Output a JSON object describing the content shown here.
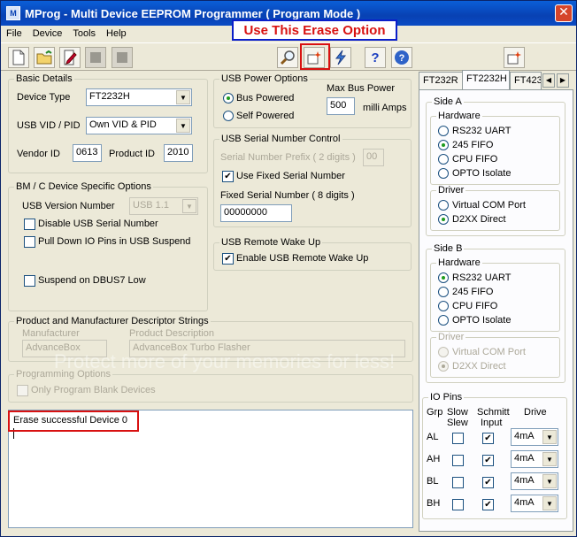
{
  "window": {
    "title": "MProg - Multi Device EEPROM Programmer ( Program Mode )",
    "close": "✕"
  },
  "menu": [
    "File",
    "Device",
    "Tools",
    "Help"
  ],
  "callout": "Use This Erase Option",
  "basic": {
    "legend": "Basic Details",
    "device_type_label": "Device Type",
    "device_type": "FT2232H",
    "vidpid_label": "USB VID / PID",
    "vidpid": "Own VID & PID",
    "vendor_label": "Vendor ID",
    "vendor": "0613",
    "product_label": "Product ID",
    "product": "2010"
  },
  "power": {
    "legend": "USB Power Options",
    "bus": "Bus Powered",
    "self": "Self Powered",
    "max_label": "Max Bus Power",
    "max": "500",
    "unit": "milli Amps"
  },
  "serial": {
    "legend": "USB Serial Number Control",
    "prefix_label": "Serial Number Prefix ( 2 digits )",
    "prefix": "00",
    "fixed_chk": "Use Fixed Serial Number",
    "fixed_label": "Fixed Serial Number ( 8 digits )",
    "fixed": "00000000"
  },
  "bmc": {
    "legend": "BM / C Device Specific Options",
    "usbver_label": "USB Version Number",
    "usbver": "USB 1.1",
    "disable_serial": "Disable USB Serial Number",
    "pulldown": "Pull Down IO Pins in USB Suspend",
    "suspend": "Suspend on DBUS7 Low"
  },
  "wake": {
    "legend": "USB Remote Wake Up",
    "enable": "Enable USB Remote Wake Up"
  },
  "desc": {
    "legend": "Product and Manufacturer Descriptor Strings",
    "manu_label": "Manufacturer",
    "manu": "AdvanceBox",
    "prod_label": "Product Description",
    "prod": "AdvanceBox Turbo Flasher"
  },
  "prog": {
    "legend": "Programming Options",
    "blank": "Only Program Blank Devices"
  },
  "log": {
    "line1": "Erase successful Device 0"
  },
  "tabs": [
    "FT232R",
    "FT2232H",
    "FT423"
  ],
  "sideA": {
    "legend": "Side A",
    "hw_legend": "Hardware",
    "hw": [
      "RS232 UART",
      "245 FIFO",
      "CPU FIFO",
      "OPTO Isolate"
    ],
    "drv_legend": "Driver",
    "drv": [
      "Virtual COM Port",
      "D2XX Direct"
    ]
  },
  "sideB": {
    "legend": "Side B",
    "hw_legend": "Hardware",
    "hw": [
      "RS232 UART",
      "245 FIFO",
      "CPU FIFO",
      "OPTO Isolate"
    ],
    "drv_legend": "Driver",
    "drv": [
      "Virtual COM Port",
      "D2XX Direct"
    ]
  },
  "io": {
    "legend": "IO Pins",
    "h_grp": "Grp",
    "h_slow": "Slow",
    "h_slew": "Slew",
    "h_schmitt": "Schmitt",
    "h_input": "Input",
    "h_drive": "Drive",
    "rows": [
      {
        "grp": "AL",
        "drive": "4mA"
      },
      {
        "grp": "AH",
        "drive": "4mA"
      },
      {
        "grp": "BL",
        "drive": "4mA"
      },
      {
        "grp": "BH",
        "drive": "4mA"
      }
    ]
  },
  "watermark": "Protect more of your memories for less!",
  "glyphs": {
    "check": "✔",
    "arrow_down": "▼",
    "left": "◀",
    "right": "▶"
  }
}
